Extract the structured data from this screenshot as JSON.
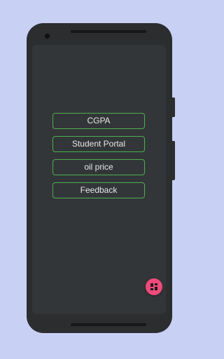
{
  "colors": {
    "background": "#c8d0f4",
    "phone_body": "#2b2d2f",
    "screen": "#333638",
    "button_border": "#4caf50",
    "button_text": "#e6e6e6",
    "fab": "#ef4a7c"
  },
  "menu": {
    "buttons": [
      {
        "label": "CGPA"
      },
      {
        "label": "Student Portal"
      },
      {
        "label": "oil price"
      },
      {
        "label": "Feedback"
      }
    ]
  },
  "fab": {
    "icon": "dashboard-grid-icon"
  }
}
